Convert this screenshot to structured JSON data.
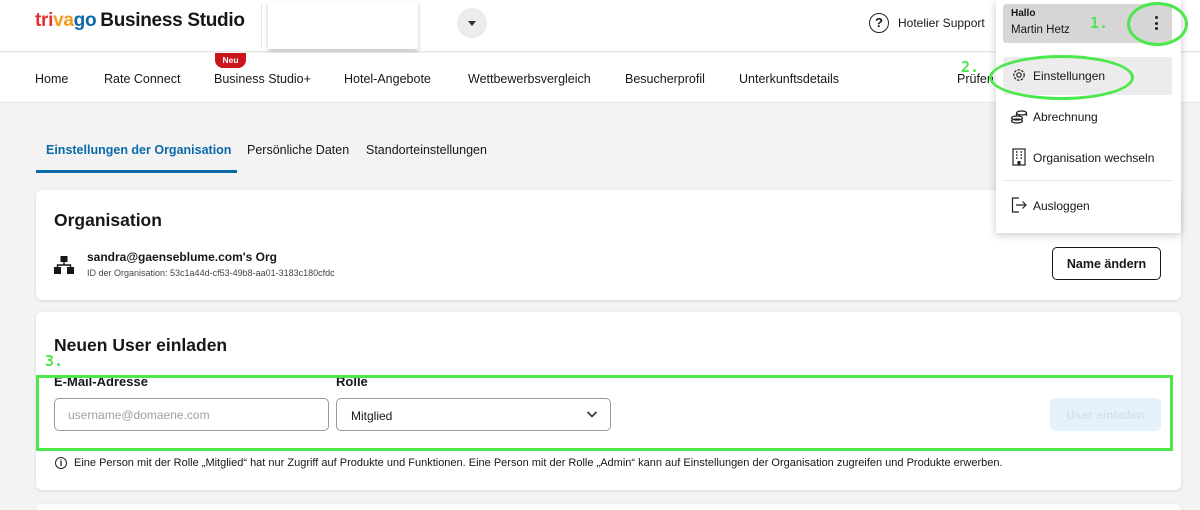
{
  "header": {
    "logo_part1": "tri",
    "logo_part2": "va",
    "logo_part3": "go",
    "logo_product": "Business Studio",
    "support_label": "Hotelier Support"
  },
  "nav": {
    "items": [
      "Home",
      "Rate Connect",
      "Business Studio+",
      "Hotel-Angebote",
      "Wettbewerbsvergleich",
      "Besucherprofil",
      "Unterkunftsdetails",
      "Prüfen"
    ],
    "new_badge": "Neu"
  },
  "tabs": [
    "Einstellungen der Organisation",
    "Persönliche Daten",
    "Standorteinstellungen"
  ],
  "organisation": {
    "title": "Organisation",
    "name": "sandra@gaenseblume.com's Org",
    "id_line": "ID der Organisation: 53c1a44d-cf53-49b8-aa01-3183c180cfdc",
    "rename_button": "Name ändern"
  },
  "invite": {
    "title": "Neuen User einladen",
    "email_label": "E-Mail-Adresse",
    "email_placeholder": "username@domaene.com",
    "email_value": "",
    "role_label": "Rolle",
    "role_value": "Mitglied",
    "invite_button": "User einladen",
    "info_text": "Eine Person mit der Rolle „Mitglied“ hat nur Zugriff auf Produkte und Funktionen. Eine Person mit der Rolle „Admin“ kann auf Einstellungen der Organisation zugreifen und Produkte erwerben."
  },
  "user_menu": {
    "greeting": "Hallo",
    "user_name": "Martin Hetz",
    "items": [
      {
        "label": "Einstellungen",
        "icon": "gear-icon"
      },
      {
        "label": "Abrechnung",
        "icon": "coins-icon"
      },
      {
        "label": "Organisation wechseln",
        "icon": "building-icon"
      },
      {
        "label": "Ausloggen",
        "icon": "logout-icon"
      }
    ]
  },
  "annotations": [
    "1.",
    "2.",
    "3."
  ],
  "colors": {
    "brand_blue": "#0a6aa8",
    "annotation_green": "#4be84b",
    "badge_red": "#c9151b"
  }
}
